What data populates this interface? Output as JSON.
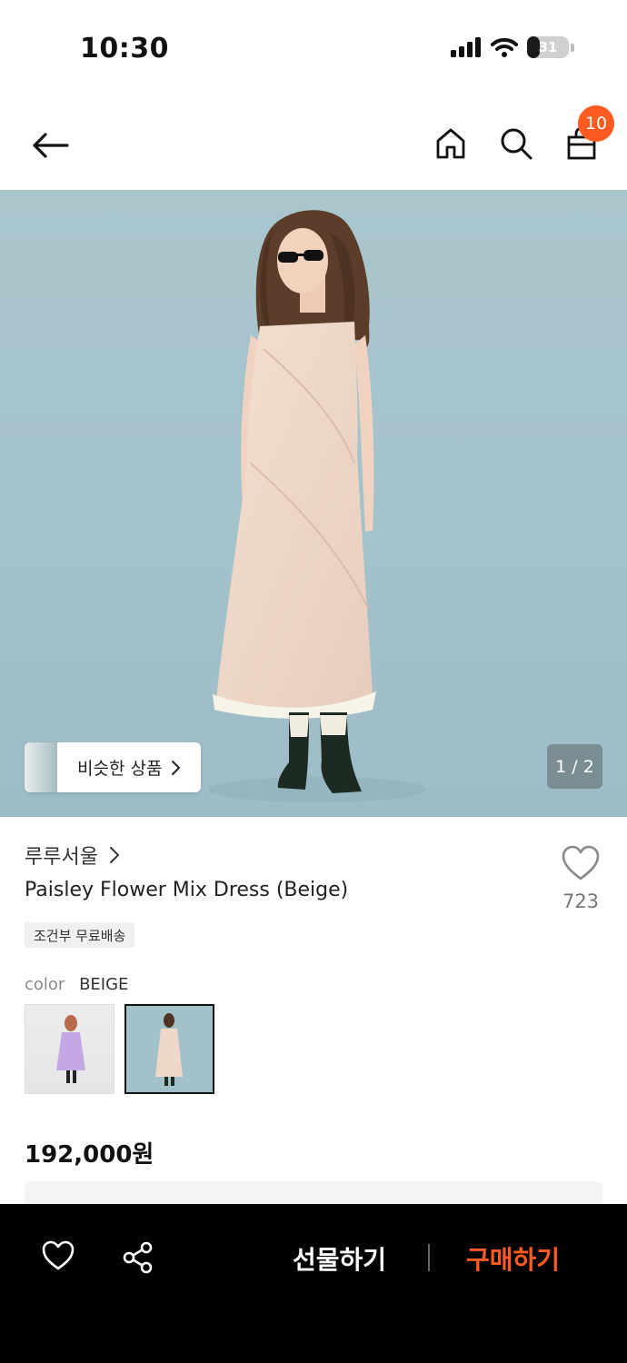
{
  "status_bar": {
    "time": "10:30",
    "battery": "31",
    "battery_level": 0.31
  },
  "header": {
    "cart_count": "10"
  },
  "gallery": {
    "similar_label": "비슷한 상품",
    "pager": "1 / 2",
    "colors": {
      "background": "#a7c4cb",
      "dress": "#efd8c9",
      "boots": "#1d2a22"
    }
  },
  "product": {
    "brand": "루루서울",
    "name": "Paisley Flower Mix Dress (Beige)",
    "shipping_badge": "조건부 무료배송",
    "like_count": "723",
    "color_label": "color",
    "color_value": "BEIGE",
    "price": "192,000원"
  },
  "bottom_bar": {
    "gift_label": "선물하기",
    "buy_label": "구매하기",
    "accent_color": "#ff5a1f"
  }
}
